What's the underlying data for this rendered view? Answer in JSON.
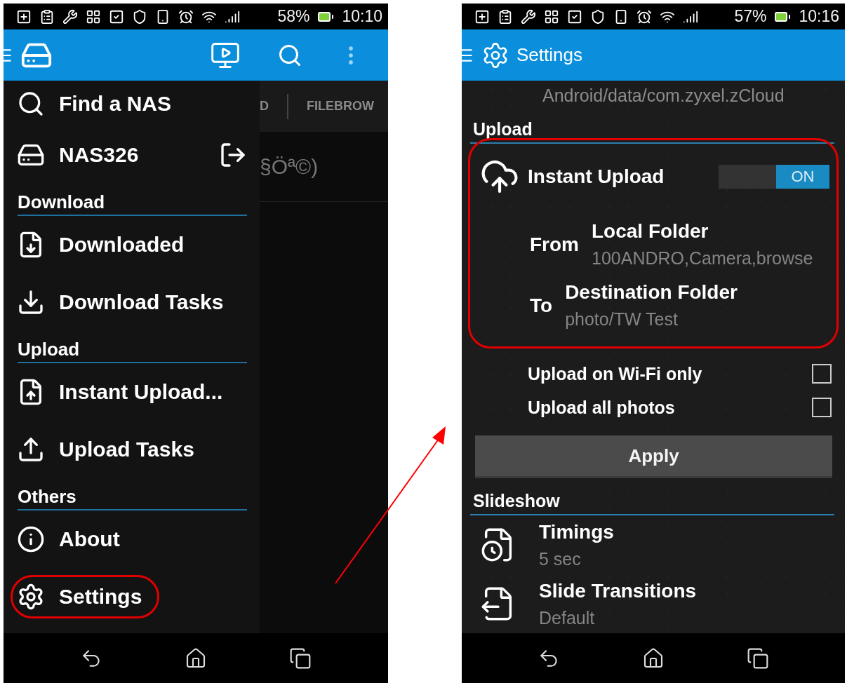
{
  "left_screen": {
    "status_bar": {
      "battery": "58%",
      "time": "10:10"
    },
    "background_view": {
      "tabs": [
        {
          "label": "D"
        },
        {
          "label": "FILEBROW"
        }
      ],
      "row_text": "§Öª©)"
    },
    "drawer": {
      "items": [
        {
          "kind": "item",
          "label": "Find a NAS",
          "highlighted": false
        },
        {
          "kind": "device",
          "label": "NAS326",
          "highlighted": false
        },
        {
          "kind": "header",
          "label": "Download"
        },
        {
          "kind": "item",
          "label": "Downloaded",
          "highlighted": false
        },
        {
          "kind": "item",
          "label": "Download Tasks",
          "highlighted": false
        },
        {
          "kind": "header",
          "label": "Upload"
        },
        {
          "kind": "item",
          "label": "Instant Upload...",
          "highlighted": false
        },
        {
          "kind": "item",
          "label": "Upload Tasks",
          "highlighted": false
        },
        {
          "kind": "header",
          "label": "Others"
        },
        {
          "kind": "item",
          "label": "About",
          "highlighted": false
        },
        {
          "kind": "item",
          "label": "Settings",
          "highlighted": true
        }
      ]
    }
  },
  "right_screen": {
    "status_bar": {
      "battery": "57%",
      "time": "10:16"
    },
    "app_bar": {
      "title": "Settings"
    },
    "cut_text": "Android/data/com.zyxel.zCloud",
    "upload": {
      "title": "Upload",
      "highlighted": true,
      "instant_upload": {
        "label": "Instant Upload",
        "toggle": {
          "label": "ON",
          "on": true
        }
      },
      "from": {
        "label": "From",
        "title": "Local Folder",
        "value": "100ANDRO,Camera,browse"
      },
      "to": {
        "label": "To",
        "title": "Destination Folder",
        "value": "photo/TW Test"
      },
      "options": [
        {
          "label": "Upload on Wi-Fi only",
          "checked": false
        },
        {
          "label": "Upload all photos",
          "checked": false
        }
      ],
      "button": "Apply"
    },
    "slideshow": {
      "title": "Slideshow",
      "items": [
        {
          "title": "Timings",
          "value": "5 sec"
        },
        {
          "title": "Slide Transitions",
          "value": "Default"
        }
      ]
    }
  }
}
